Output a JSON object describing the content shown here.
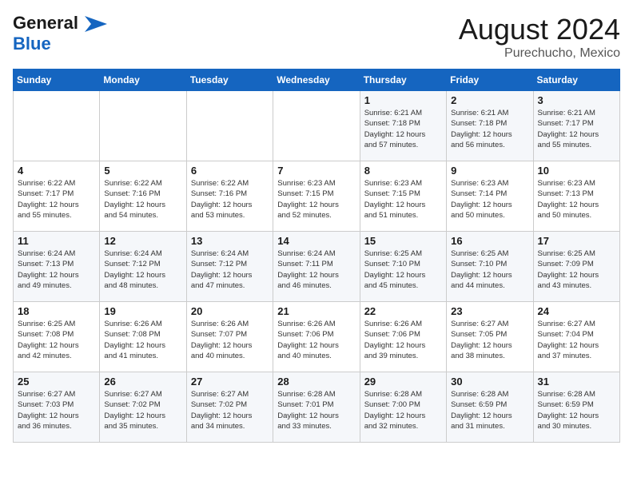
{
  "logo": {
    "general": "General",
    "blue": "Blue",
    "tagline": ""
  },
  "header": {
    "month_year": "August 2024",
    "location": "Purechucho, Mexico"
  },
  "weekdays": [
    "Sunday",
    "Monday",
    "Tuesday",
    "Wednesday",
    "Thursday",
    "Friday",
    "Saturday"
  ],
  "weeks": [
    [
      {
        "day": "",
        "detail": ""
      },
      {
        "day": "",
        "detail": ""
      },
      {
        "day": "",
        "detail": ""
      },
      {
        "day": "",
        "detail": ""
      },
      {
        "day": "1",
        "detail": "Sunrise: 6:21 AM\nSunset: 7:18 PM\nDaylight: 12 hours\nand 57 minutes."
      },
      {
        "day": "2",
        "detail": "Sunrise: 6:21 AM\nSunset: 7:18 PM\nDaylight: 12 hours\nand 56 minutes."
      },
      {
        "day": "3",
        "detail": "Sunrise: 6:21 AM\nSunset: 7:17 PM\nDaylight: 12 hours\nand 55 minutes."
      }
    ],
    [
      {
        "day": "4",
        "detail": "Sunrise: 6:22 AM\nSunset: 7:17 PM\nDaylight: 12 hours\nand 55 minutes."
      },
      {
        "day": "5",
        "detail": "Sunrise: 6:22 AM\nSunset: 7:16 PM\nDaylight: 12 hours\nand 54 minutes."
      },
      {
        "day": "6",
        "detail": "Sunrise: 6:22 AM\nSunset: 7:16 PM\nDaylight: 12 hours\nand 53 minutes."
      },
      {
        "day": "7",
        "detail": "Sunrise: 6:23 AM\nSunset: 7:15 PM\nDaylight: 12 hours\nand 52 minutes."
      },
      {
        "day": "8",
        "detail": "Sunrise: 6:23 AM\nSunset: 7:15 PM\nDaylight: 12 hours\nand 51 minutes."
      },
      {
        "day": "9",
        "detail": "Sunrise: 6:23 AM\nSunset: 7:14 PM\nDaylight: 12 hours\nand 50 minutes."
      },
      {
        "day": "10",
        "detail": "Sunrise: 6:23 AM\nSunset: 7:13 PM\nDaylight: 12 hours\nand 50 minutes."
      }
    ],
    [
      {
        "day": "11",
        "detail": "Sunrise: 6:24 AM\nSunset: 7:13 PM\nDaylight: 12 hours\nand 49 minutes."
      },
      {
        "day": "12",
        "detail": "Sunrise: 6:24 AM\nSunset: 7:12 PM\nDaylight: 12 hours\nand 48 minutes."
      },
      {
        "day": "13",
        "detail": "Sunrise: 6:24 AM\nSunset: 7:12 PM\nDaylight: 12 hours\nand 47 minutes."
      },
      {
        "day": "14",
        "detail": "Sunrise: 6:24 AM\nSunset: 7:11 PM\nDaylight: 12 hours\nand 46 minutes."
      },
      {
        "day": "15",
        "detail": "Sunrise: 6:25 AM\nSunset: 7:10 PM\nDaylight: 12 hours\nand 45 minutes."
      },
      {
        "day": "16",
        "detail": "Sunrise: 6:25 AM\nSunset: 7:10 PM\nDaylight: 12 hours\nand 44 minutes."
      },
      {
        "day": "17",
        "detail": "Sunrise: 6:25 AM\nSunset: 7:09 PM\nDaylight: 12 hours\nand 43 minutes."
      }
    ],
    [
      {
        "day": "18",
        "detail": "Sunrise: 6:25 AM\nSunset: 7:08 PM\nDaylight: 12 hours\nand 42 minutes."
      },
      {
        "day": "19",
        "detail": "Sunrise: 6:26 AM\nSunset: 7:08 PM\nDaylight: 12 hours\nand 41 minutes."
      },
      {
        "day": "20",
        "detail": "Sunrise: 6:26 AM\nSunset: 7:07 PM\nDaylight: 12 hours\nand 40 minutes."
      },
      {
        "day": "21",
        "detail": "Sunrise: 6:26 AM\nSunset: 7:06 PM\nDaylight: 12 hours\nand 40 minutes."
      },
      {
        "day": "22",
        "detail": "Sunrise: 6:26 AM\nSunset: 7:06 PM\nDaylight: 12 hours\nand 39 minutes."
      },
      {
        "day": "23",
        "detail": "Sunrise: 6:27 AM\nSunset: 7:05 PM\nDaylight: 12 hours\nand 38 minutes."
      },
      {
        "day": "24",
        "detail": "Sunrise: 6:27 AM\nSunset: 7:04 PM\nDaylight: 12 hours\nand 37 minutes."
      }
    ],
    [
      {
        "day": "25",
        "detail": "Sunrise: 6:27 AM\nSunset: 7:03 PM\nDaylight: 12 hours\nand 36 minutes."
      },
      {
        "day": "26",
        "detail": "Sunrise: 6:27 AM\nSunset: 7:02 PM\nDaylight: 12 hours\nand 35 minutes."
      },
      {
        "day": "27",
        "detail": "Sunrise: 6:27 AM\nSunset: 7:02 PM\nDaylight: 12 hours\nand 34 minutes."
      },
      {
        "day": "28",
        "detail": "Sunrise: 6:28 AM\nSunset: 7:01 PM\nDaylight: 12 hours\nand 33 minutes."
      },
      {
        "day": "29",
        "detail": "Sunrise: 6:28 AM\nSunset: 7:00 PM\nDaylight: 12 hours\nand 32 minutes."
      },
      {
        "day": "30",
        "detail": "Sunrise: 6:28 AM\nSunset: 6:59 PM\nDaylight: 12 hours\nand 31 minutes."
      },
      {
        "day": "31",
        "detail": "Sunrise: 6:28 AM\nSunset: 6:59 PM\nDaylight: 12 hours\nand 30 minutes."
      }
    ]
  ]
}
